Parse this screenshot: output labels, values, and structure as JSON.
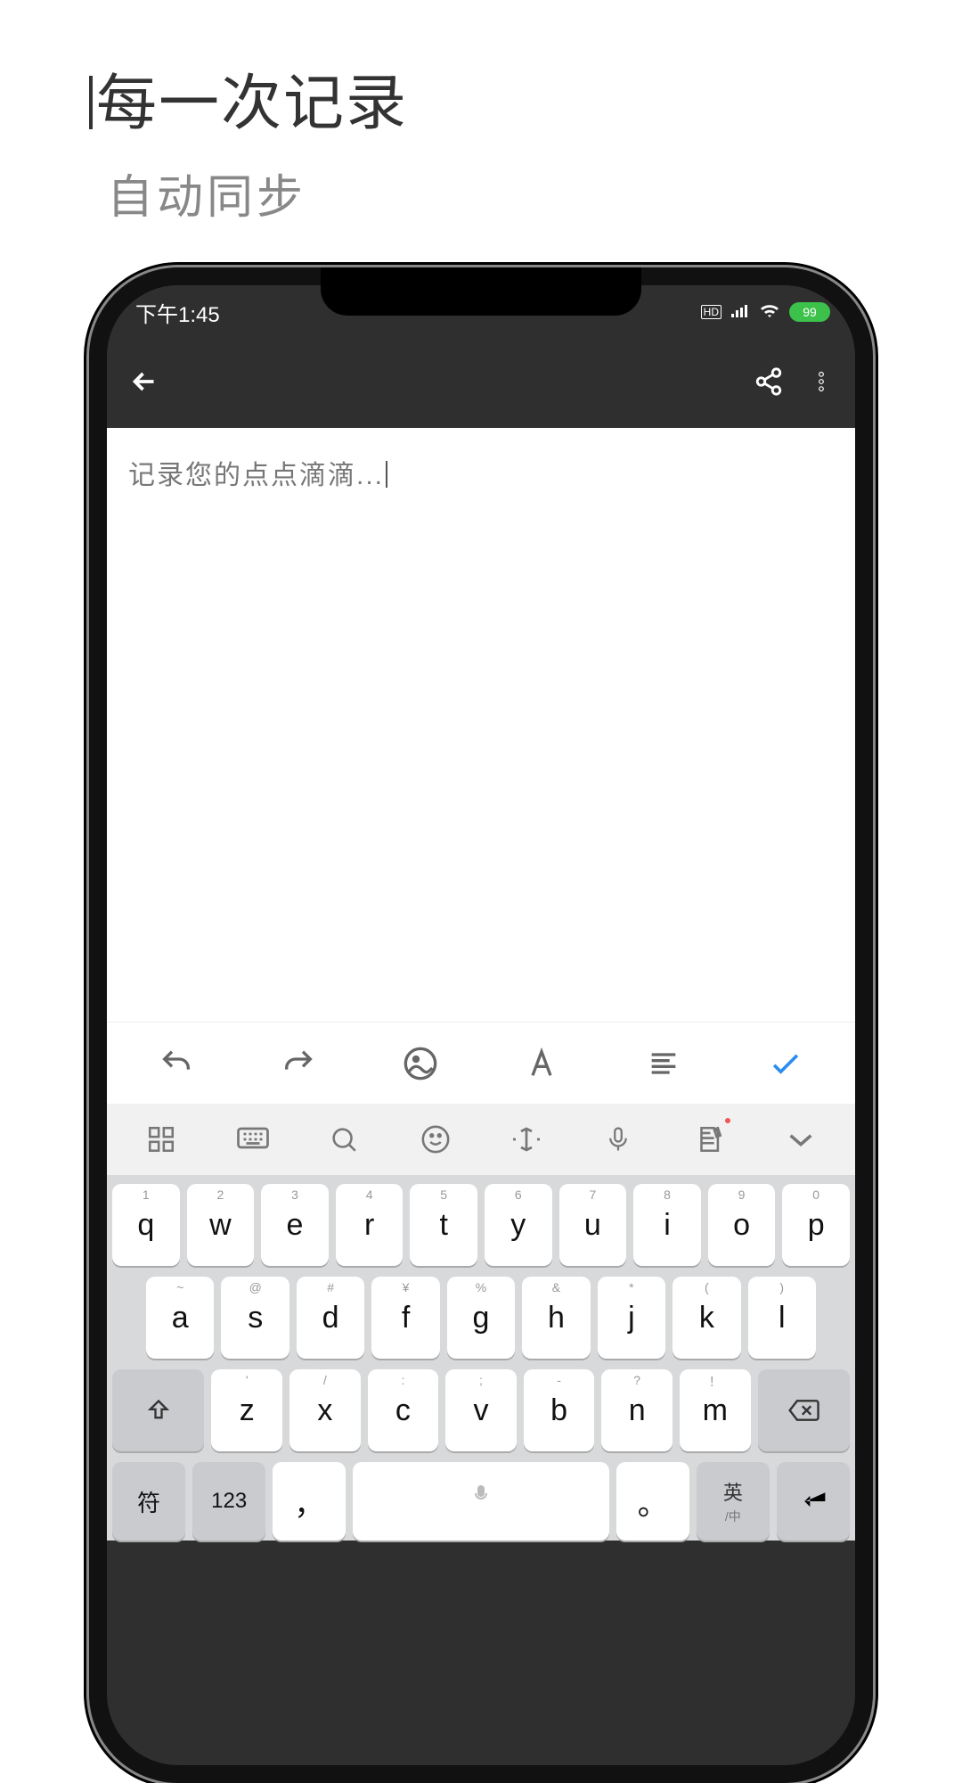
{
  "promo": {
    "line1": "每一次记录",
    "line2": "自动同步"
  },
  "status": {
    "time": "下午1:45",
    "hd": "HD",
    "battery": "99"
  },
  "editor": {
    "placeholder": "记录您的点点滴滴..."
  },
  "keyboard": {
    "row1": [
      {
        "k": "q",
        "s": "1"
      },
      {
        "k": "w",
        "s": "2"
      },
      {
        "k": "e",
        "s": "3"
      },
      {
        "k": "r",
        "s": "4"
      },
      {
        "k": "t",
        "s": "5"
      },
      {
        "k": "y",
        "s": "6"
      },
      {
        "k": "u",
        "s": "7"
      },
      {
        "k": "i",
        "s": "8"
      },
      {
        "k": "o",
        "s": "9"
      },
      {
        "k": "p",
        "s": "0"
      }
    ],
    "row2": [
      {
        "k": "a",
        "s": "~"
      },
      {
        "k": "s",
        "s": "@"
      },
      {
        "k": "d",
        "s": "#"
      },
      {
        "k": "f",
        "s": "¥"
      },
      {
        "k": "g",
        "s": "%"
      },
      {
        "k": "h",
        "s": "&"
      },
      {
        "k": "j",
        "s": "*"
      },
      {
        "k": "k",
        "s": "("
      },
      {
        "k": "l",
        "s": ")"
      }
    ],
    "row3": [
      {
        "k": "z",
        "s": "'"
      },
      {
        "k": "x",
        "s": "/"
      },
      {
        "k": "c",
        "s": ":"
      },
      {
        "k": "v",
        "s": ";"
      },
      {
        "k": "b",
        "s": "-"
      },
      {
        "k": "n",
        "s": "?"
      },
      {
        "k": "m",
        "s": "！"
      }
    ],
    "bottom": {
      "sym": "符",
      "num": "123",
      "comma": "，",
      "period": "。",
      "lang_primary": "英",
      "lang_secondary": "/中"
    }
  }
}
